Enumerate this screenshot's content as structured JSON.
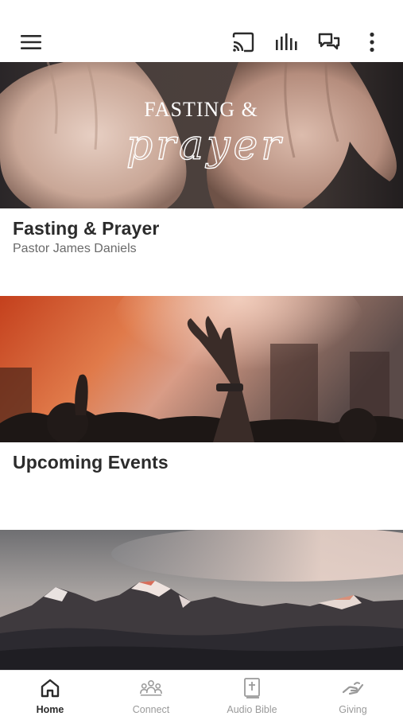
{
  "colors": {
    "text_primary": "#2b2b2b",
    "text_secondary": "#6a6a6a",
    "nav_inactive": "#9a9a9a",
    "nav_active": "#2b2b2b"
  },
  "app_bar": {
    "menu_icon": "hamburger-menu-icon",
    "actions": [
      {
        "icon": "cast-icon"
      },
      {
        "icon": "audio-bars-icon"
      },
      {
        "icon": "chat-bubbles-icon"
      },
      {
        "icon": "more-vertical-icon"
      }
    ]
  },
  "feed": {
    "cards": [
      {
        "image_title_line1": "FASTING &",
        "image_title_line2": "prayer",
        "title": "Fasting & Prayer",
        "subtitle": "Pastor James Daniels"
      },
      {
        "title": "Upcoming Events",
        "subtitle": ""
      },
      {
        "title": "",
        "subtitle": ""
      }
    ]
  },
  "bottom_nav": {
    "tabs": [
      {
        "label": "Home",
        "icon": "home-icon",
        "active": true
      },
      {
        "label": "Connect",
        "icon": "people-group-icon",
        "active": false
      },
      {
        "label": "Audio Bible",
        "icon": "bible-book-icon",
        "active": false
      },
      {
        "label": "Giving",
        "icon": "giving-hand-icon",
        "active": false
      }
    ]
  }
}
